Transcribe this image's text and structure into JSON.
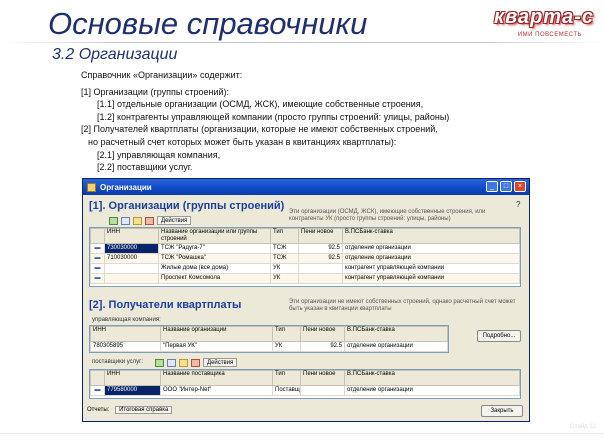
{
  "slide": {
    "title": "Основые справочники",
    "subtitle": "3.2  Организации",
    "logo": {
      "name": "кварта-с",
      "tagline": "ИМИ ПОВСЕМЕСТЬ"
    },
    "body": [
      "Справочник «Организации» содержит:",
      "[1] Организации (группы строений):",
      "[1.1]  отдельные организации (ОСМД, ЖСК), имеющие собственные строения,",
      "[1.2]  контрагенты управляющей компании (просто группы строений: улицы, районы)",
      "[2]  Получателей квартплаты (организации, которые не имеют собственных строений,",
      "но расчетный счет которых  может быть указан в квитанциях квартплаты):",
      "[2.1]  управляющая компания,",
      "[2.2]  поставщики услуг."
    ],
    "footer": "Слайд 12"
  },
  "window": {
    "title": "Организации",
    "buttons": {
      "minimize": "_",
      "maximize": "□",
      "close": "×"
    },
    "help": "?",
    "section1": {
      "title": "[1]. Организации (группы строений)",
      "note": "Эти организации (ОСМД, ЖСК), имеющие собственные строения, или контрагенты УК (просто группы строений: улицы, районы)",
      "actions": "Действия",
      "columns": [
        "ИНН",
        "Название организации или группы строений",
        "Тип",
        "Пени новое",
        "В.ПСБанк-ставка"
      ],
      "rows": [
        {
          "mark": "▬",
          "inn": "730030000",
          "name": "ТСЖ \"Радуга-7\"",
          "type": "ТСЖ",
          "peni": "92.5",
          "bank": "отделение организации"
        },
        {
          "mark": "▬",
          "inn": "710030000",
          "name": "ТСЖ \"Ромашка\"",
          "type": "ТСЖ",
          "peni": "92.5",
          "bank": "отделение организации"
        },
        {
          "mark": "▬",
          "inn": "",
          "name": "Жилые дома (все дома)",
          "type": "УК",
          "peni": "",
          "bank": "контрагент управляющей компании"
        },
        {
          "mark": "▬",
          "inn": "",
          "name": "Проспект Комсомола",
          "type": "УК",
          "peni": "",
          "bank": "контрагент управляющей компании"
        }
      ]
    },
    "section2": {
      "title": "[2]. Получатели квартплаты",
      "note": "Эти организации не имеют собственных строений, однако расчетный счет может быть указан в квитанции квартплаты",
      "subtitle_uk": "управляющая компания:",
      "columns_uk": [
        "ИНН",
        "Название организации",
        "Тип",
        "Пени новое",
        "В.ПСБанк-ставка"
      ],
      "row_uk": {
        "inn": "780305895",
        "name": "\"Первая УК\"",
        "type": "УК",
        "peni": "92.5",
        "bank": "отделение организации"
      },
      "detail_button": "Подробно...",
      "subtitle_suppliers": "поставщики услуг:",
      "actions": "Действия",
      "columns_sup": [
        "ИНН",
        "Название поставщика",
        "Тип",
        "Пени новое",
        "В.ПСБанк-ставка"
      ],
      "row_sup": {
        "mark": "▬",
        "inn": "779580000",
        "name": "ООО \"Интер-Net\"",
        "type": "Поставщ",
        "peni": "",
        "bank": "отделение организации"
      }
    },
    "status": {
      "label": "Отчеты:",
      "value": "Итоговая справка"
    },
    "close_button": "Закрыть"
  }
}
